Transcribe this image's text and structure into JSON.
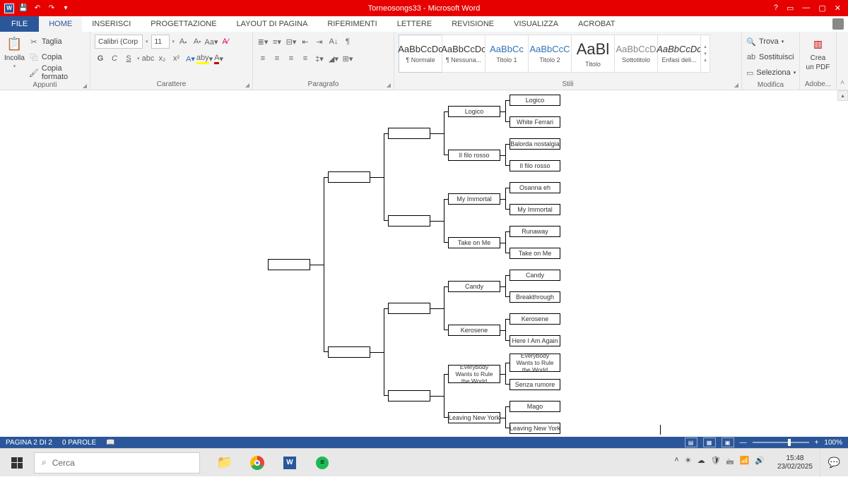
{
  "titlebar": {
    "title": "Torneosongs33 - Microsoft Word"
  },
  "tabs": {
    "file": "FILE",
    "items": [
      "HOME",
      "INSERISCI",
      "PROGETTAZIONE",
      "LAYOUT DI PAGINA",
      "RIFERIMENTI",
      "LETTERE",
      "REVISIONE",
      "VISUALIZZA",
      "ACROBAT"
    ]
  },
  "ribbon": {
    "clipboard": {
      "label": "Appunti",
      "paste": "Incolla",
      "cut": "Taglia",
      "copy": "Copia",
      "formatPainter": "Copia formato"
    },
    "font": {
      "label": "Carattere",
      "name": "Calibri (Corp",
      "size": "11",
      "bold": "G",
      "italic": "C",
      "underline": "S"
    },
    "paragraph": {
      "label": "Paragrafo"
    },
    "styles": {
      "label": "Stili",
      "items": [
        {
          "preview": "AaBbCcDc",
          "name": "¶ Normale"
        },
        {
          "preview": "AaBbCcDc",
          "name": "¶ Nessuna..."
        },
        {
          "preview": "AaBbCc",
          "name": "Titolo 1"
        },
        {
          "preview": "AaBbCcC",
          "name": "Titolo 2"
        },
        {
          "preview": "AaBl",
          "name": "Titolo"
        },
        {
          "preview": "AaBbCcD",
          "name": "Sottotitolo"
        },
        {
          "preview": "AaBbCcDc",
          "name": "Enfasi deli..."
        }
      ]
    },
    "editing": {
      "label": "Modifica",
      "find": "Trova",
      "replace": "Sostituisci",
      "select": "Seleziona"
    },
    "adobe": {
      "label": "Adobe...",
      "createPdf1": "Crea",
      "createPdf2": "un PDF"
    }
  },
  "bracket": {
    "r16": [
      "Logico",
      "White Ferrari",
      "Balorda nostalgia",
      "Il filo rosso",
      "Osanna eh",
      "My Immortal",
      "Runaway",
      "Take on Me",
      "Candy",
      "Breakthrough",
      "Kerosene",
      "Here I Am Again",
      "Everybody Wants to Rule the World",
      "Senza rumore",
      "Mago",
      "Leaving New York"
    ],
    "qf": [
      "Logico",
      "Il filo rosso",
      "My Immortal",
      "Take on Me",
      "Candy",
      "Kerosene",
      "Everybody Wants to Rule the World",
      "Leaving New York"
    ],
    "sf": [
      "",
      "",
      "",
      ""
    ],
    "f": [
      "",
      ""
    ],
    "w": [
      ""
    ]
  },
  "statusbar": {
    "page": "PAGINA 2 DI 2",
    "words": "0 PAROLE",
    "zoom": "100%"
  },
  "taskbar": {
    "search": "Cerca",
    "time": "15:48",
    "date": "23/02/2025"
  }
}
